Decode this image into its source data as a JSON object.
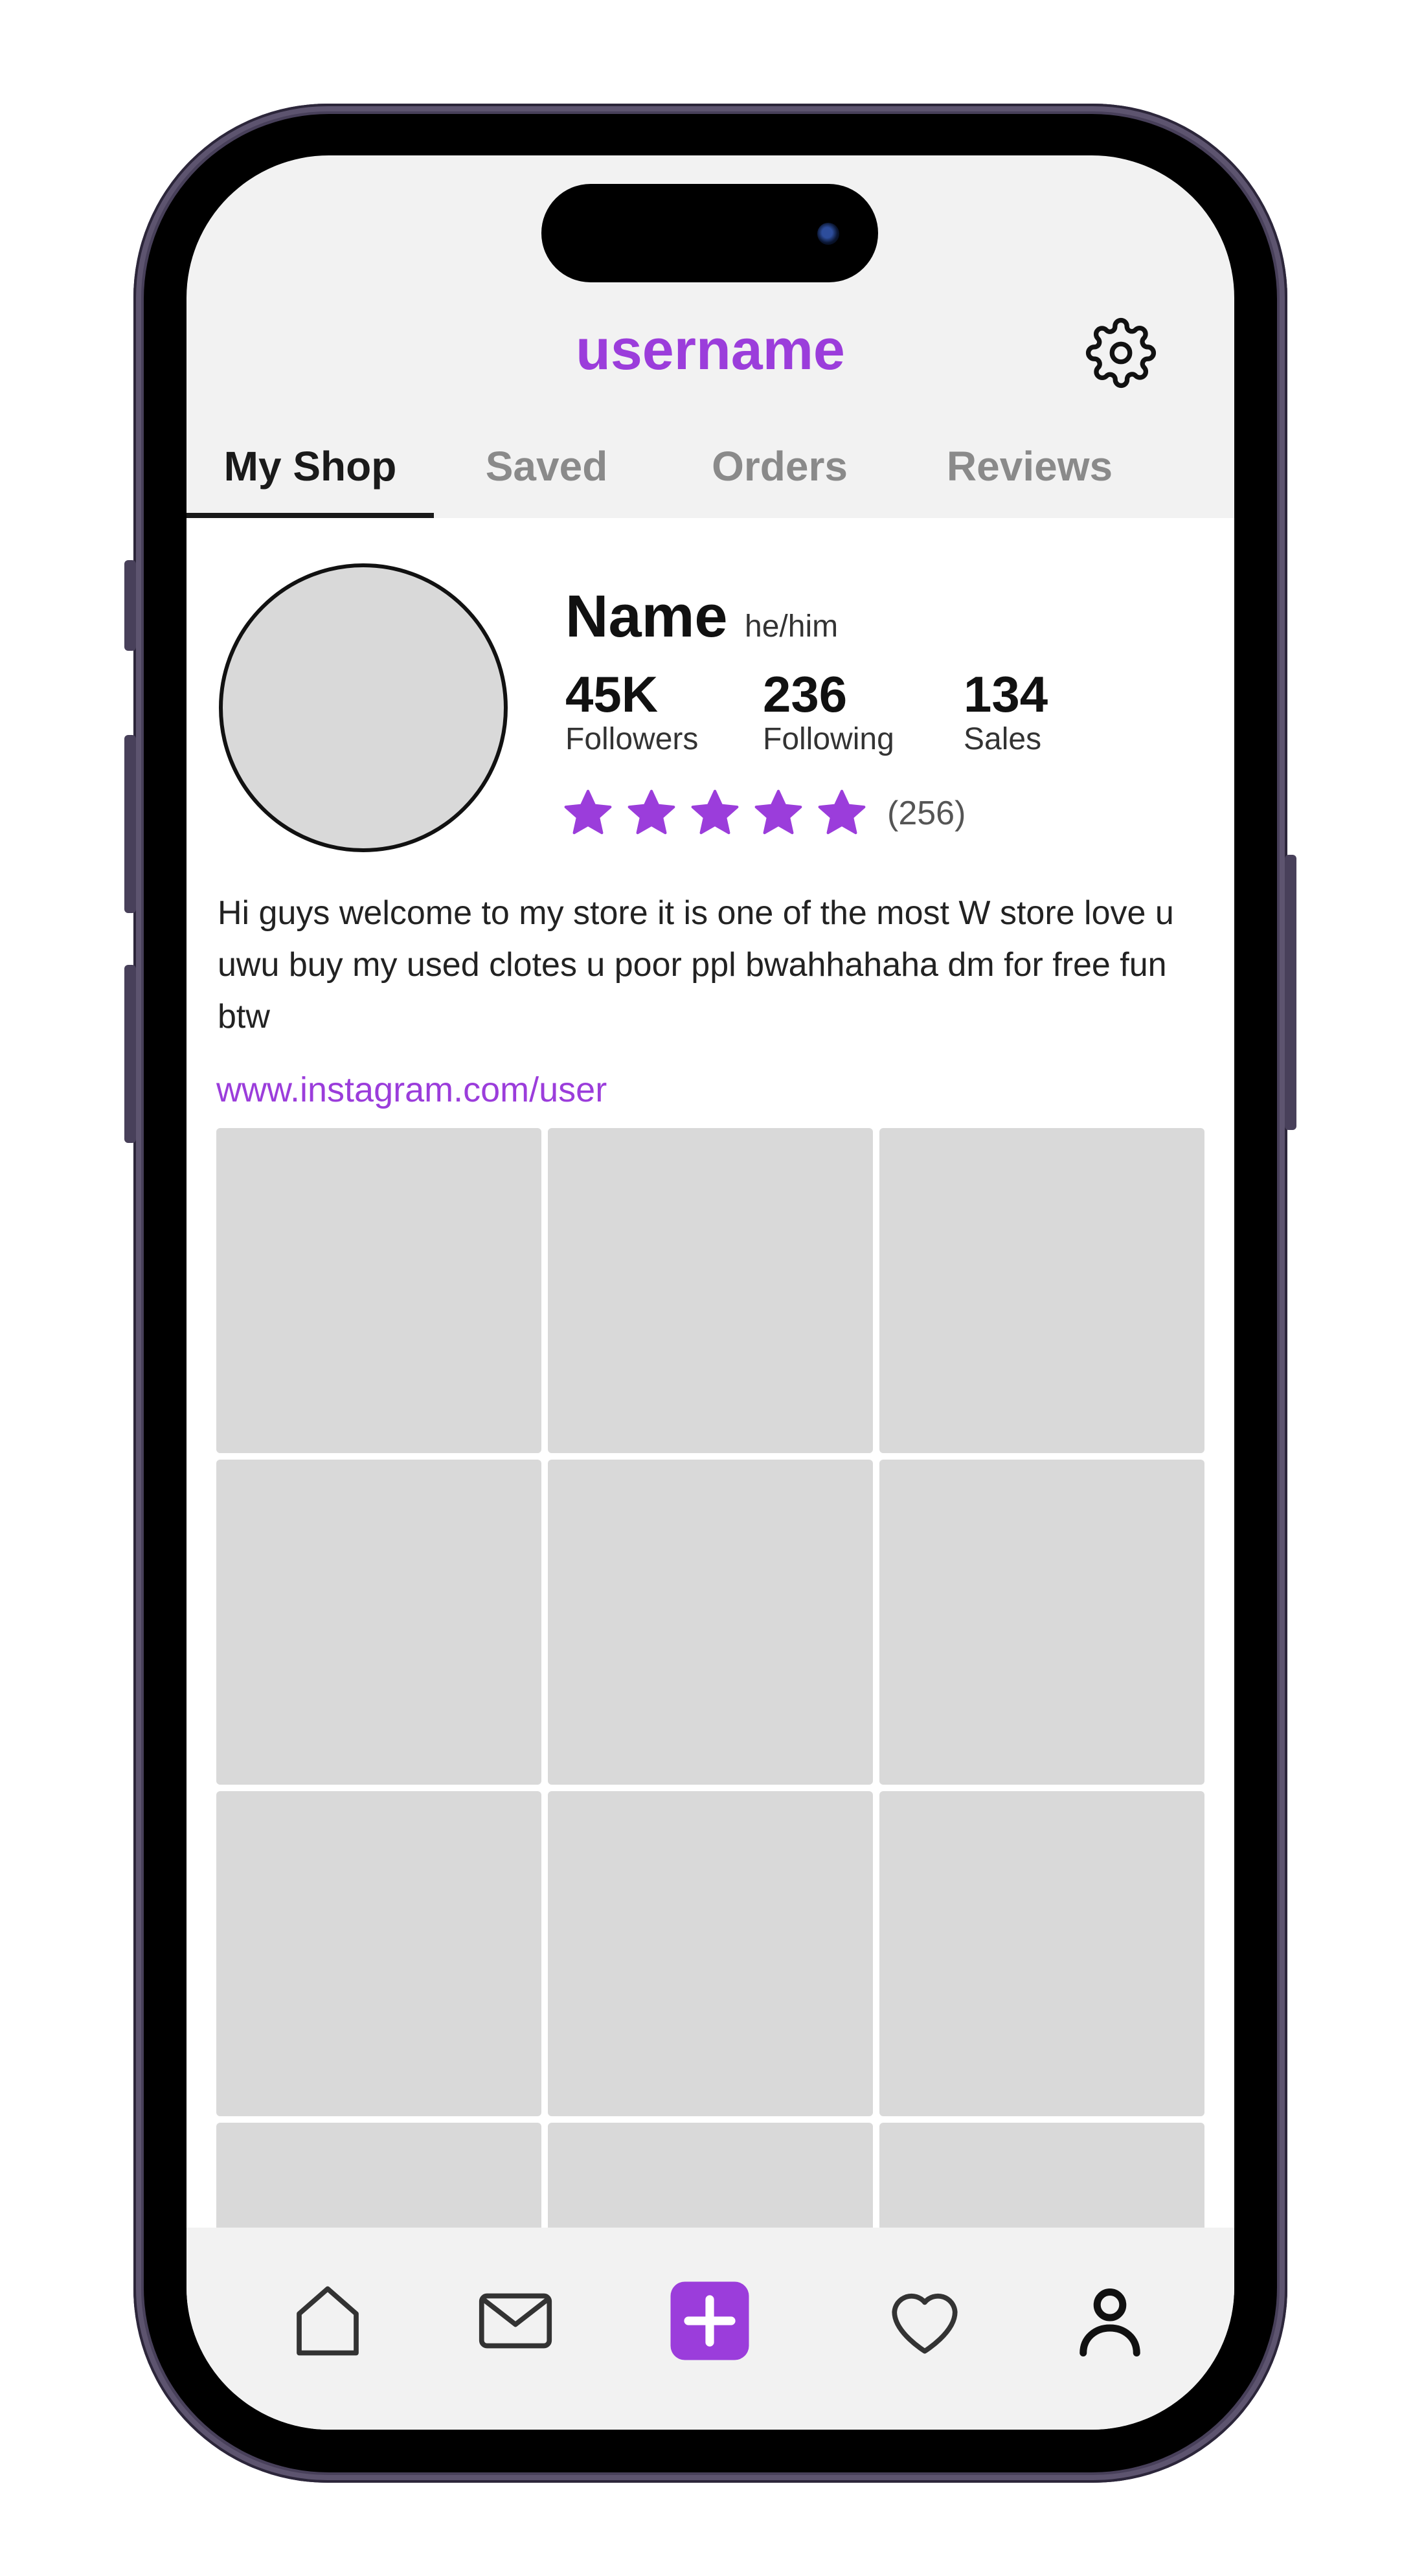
{
  "header": {
    "title": "username"
  },
  "tabs": [
    {
      "label": "My Shop",
      "active": true
    },
    {
      "label": "Saved",
      "active": false
    },
    {
      "label": "Orders",
      "active": false
    },
    {
      "label": "Reviews",
      "active": false
    }
  ],
  "profile": {
    "name": "Name",
    "pronouns": "he/him",
    "stats": [
      {
        "value": "45K",
        "label": "Followers"
      },
      {
        "value": "236",
        "label": "Following"
      },
      {
        "value": "134",
        "label": "Sales"
      }
    ],
    "rating_stars": 5,
    "review_count": "(256)",
    "bio": "Hi guys welcome to my store it is one of the most W store love u uwu buy my used clotes u poor ppl bwahhahaha dm for free fun btw",
    "link": "www.instagram.com/user"
  },
  "listings_grid": {
    "columns": 3,
    "visible_cells": 12
  },
  "bottom_nav": [
    {
      "icon": "home-icon"
    },
    {
      "icon": "mail-icon"
    },
    {
      "icon": "add-icon"
    },
    {
      "icon": "heart-icon"
    },
    {
      "icon": "profile-icon"
    }
  ],
  "colors": {
    "accent": "#9b3ddb",
    "screen_background": "#f2f2f2",
    "placeholder_gray": "#d9d9d9",
    "text_dark": "#111111",
    "tab_inactive": "#8a8a8a"
  }
}
